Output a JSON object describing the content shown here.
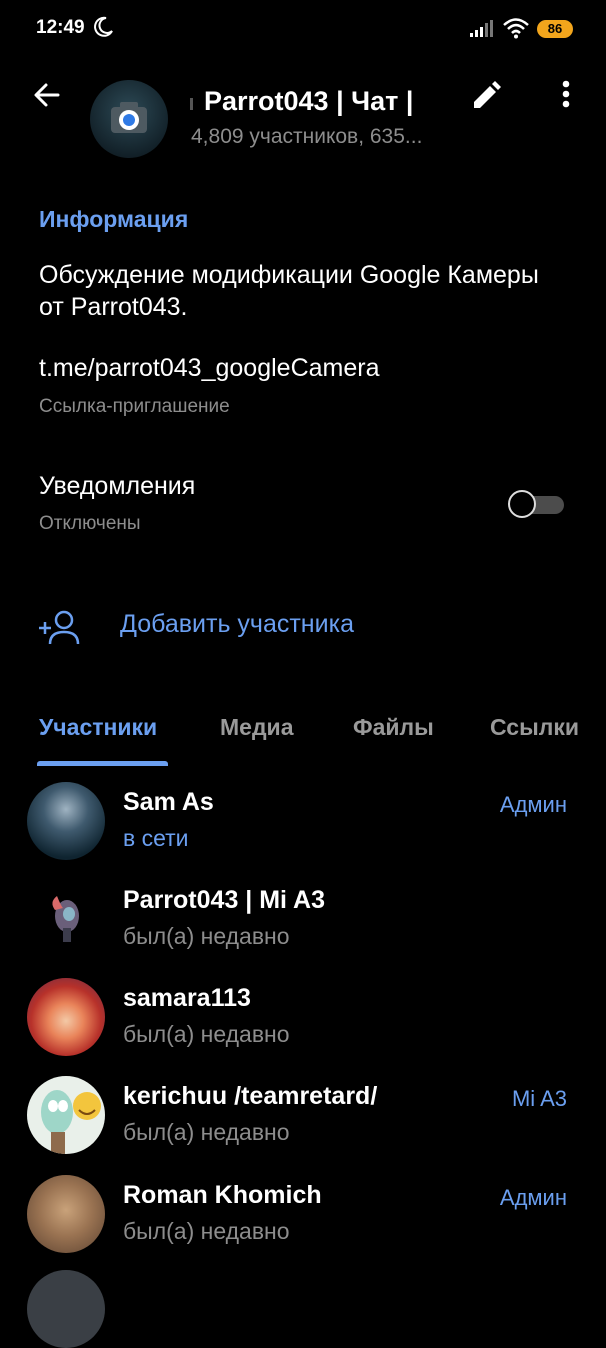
{
  "status_bar": {
    "time": "12:49",
    "battery": "86"
  },
  "header": {
    "title": "Parrot043 | Чат |",
    "subtitle": "4,809 участников, 635..."
  },
  "info": {
    "heading": "Информация",
    "description": "Обсуждение модификации Google Камеры от Parrot043.",
    "link": "t.me/parrot043_googleCamera",
    "link_caption": "Ссылка-приглашение",
    "notifications_label": "Уведомления",
    "notifications_state": "Отключены",
    "notifications_enabled": false
  },
  "add_member_label": "Добавить участника",
  "tabs": [
    {
      "label": "Участники",
      "active": true
    },
    {
      "label": "Медиа",
      "active": false
    },
    {
      "label": "Файлы",
      "active": false
    },
    {
      "label": "Ссылки",
      "active": false
    }
  ],
  "members": [
    {
      "name": "Sam As",
      "status": "в сети",
      "online": true,
      "role": "Админ"
    },
    {
      "name": "Parrot043 | Mi A3",
      "status": "был(а) недавно",
      "online": false,
      "role": ""
    },
    {
      "name": "samara113",
      "status": "был(а) недавно",
      "online": false,
      "role": ""
    },
    {
      "name": "kerichuu /teamretard/",
      "status": "был(а) недавно",
      "online": false,
      "role": "Mi A3"
    },
    {
      "name": "Roman Khomich",
      "status": "был(а) недавно",
      "online": false,
      "role": "Админ"
    }
  ],
  "colors": {
    "accent": "#6b9ff0",
    "background": "#000000",
    "secondary_text": "#8d8d8d",
    "battery": "#f2a51c"
  },
  "icons": [
    "back-arrow-icon",
    "pencil-icon",
    "more-vert-icon",
    "add-person-icon",
    "camera-icon",
    "moon-icon",
    "signal-icon",
    "wifi-icon"
  ]
}
